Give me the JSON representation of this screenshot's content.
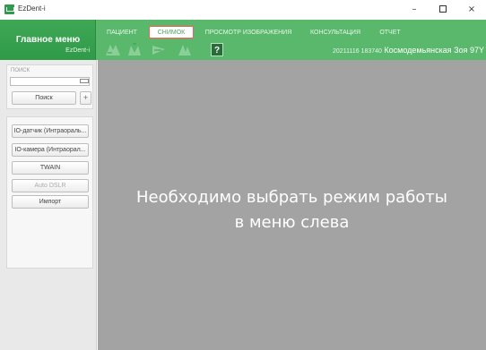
{
  "window": {
    "title": "EzDent-i",
    "controls": {
      "minimize": "–",
      "maximize": "□",
      "close": "×"
    }
  },
  "header": {
    "main_menu_title": "Главное меню",
    "main_menu_subtitle": "EzDent-i",
    "tabs": [
      {
        "label": "ПАЦИЕНТ",
        "active": false
      },
      {
        "label": "СНИМОК",
        "active": true
      },
      {
        "label": "ПРОСМОТР ИЗОБРАЖЕНИЯ",
        "active": false
      },
      {
        "label": "КОНСУЛЬТАЦИЯ",
        "active": false
      },
      {
        "label": "ОТЧЕТ",
        "active": false
      }
    ],
    "toolbar_icons": [
      "tooth-scan-icon",
      "tooth-scan-icon",
      "tooth-scan-icon",
      "tooth-scan-icon"
    ],
    "help_label": "?",
    "patient_id": "20211116 183740",
    "patient_name": "Космодемьянская Зоя 97Y"
  },
  "sidebar": {
    "search_title": "ПОИСК",
    "search_value": "",
    "search_button": "Поиск",
    "plus_button": "+",
    "modes": [
      {
        "label": "IO-датчик (Интраораль...",
        "enabled": true
      },
      {
        "label": "IO-камера (Интраорал...",
        "enabled": true
      },
      {
        "label": "TWAIN",
        "enabled": true
      },
      {
        "label": "Auto DSLR",
        "enabled": false
      },
      {
        "label": "Импорт",
        "enabled": true
      }
    ]
  },
  "main": {
    "message_line1": "Необходимо выбрать режим работы",
    "message_line2": "в меню слева"
  },
  "colors": {
    "header_green": "#59b86b",
    "header_dark_green": "#2f9a48",
    "active_tab_border": "#ff5b5b",
    "main_gray": "#a3a3a3",
    "sidebar_gray": "#e9e9e9"
  }
}
